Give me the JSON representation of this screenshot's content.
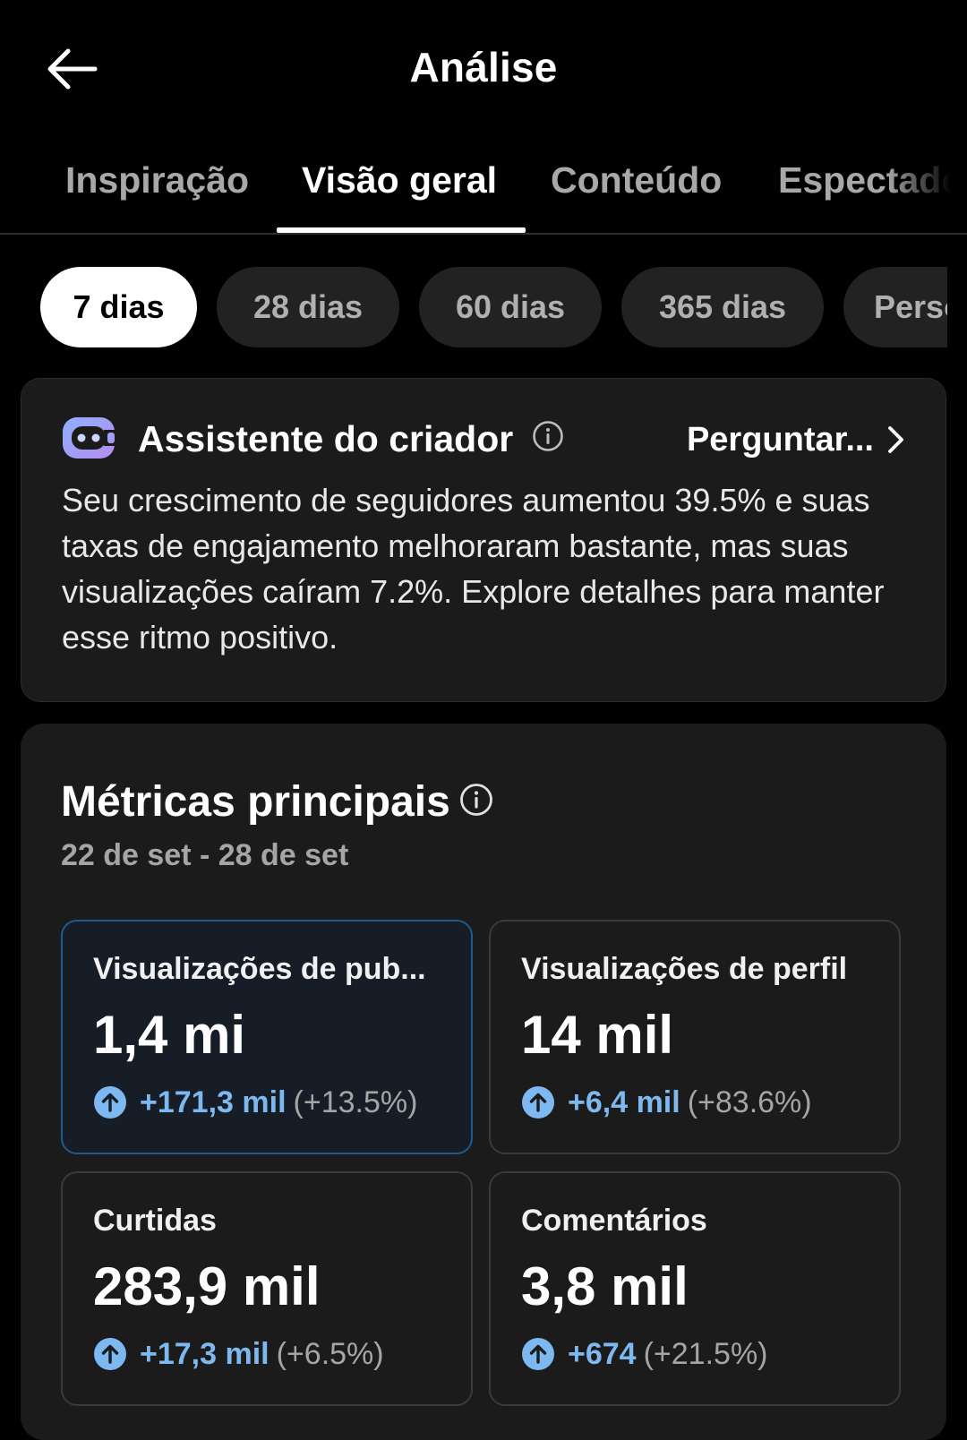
{
  "header": {
    "title": "Análise"
  },
  "tabs": [
    {
      "label": "Inspiração",
      "active": false
    },
    {
      "label": "Visão geral",
      "active": true
    },
    {
      "label": "Conteúdo",
      "active": false
    },
    {
      "label": "Espectadores",
      "active": false
    }
  ],
  "periods": [
    {
      "label": "7 dias",
      "active": true
    },
    {
      "label": "28 dias",
      "active": false
    },
    {
      "label": "60 dias",
      "active": false
    },
    {
      "label": "365 dias",
      "active": false
    },
    {
      "label": "Personalizado",
      "active": false
    }
  ],
  "assistant": {
    "title": "Assistente do criador",
    "ask_label": "Perguntar...",
    "message": "Seu crescimento de seguidores aumentou 39.5% e suas taxas de engajamento melhoraram bastante, mas suas visualizações caíram 7.2%. Explore detalhes para manter esse ritmo positivo."
  },
  "metrics": {
    "title": "Métricas principais",
    "range": "22 de set - 28 de set",
    "tiles": [
      {
        "label": "Visualizações de pub...",
        "value": "1,4 mi",
        "delta": "+171,3 mil",
        "percent": "(+13.5%)",
        "selected": true
      },
      {
        "label": "Visualizações de perfil",
        "value": "14 mil",
        "delta": "+6,4 mil",
        "percent": "(+83.6%)",
        "selected": false
      },
      {
        "label": "Curtidas",
        "value": "283,9 mil",
        "delta": "+17,3 mil",
        "percent": "(+6.5%)",
        "selected": false
      },
      {
        "label": "Comentários",
        "value": "3,8 mil",
        "delta": "+674",
        "percent": "(+21.5%)",
        "selected": false
      }
    ]
  },
  "colors": {
    "accent_blue": "#7eb8f0",
    "background": "#000000",
    "card": "#1b1b1b"
  },
  "icons": {
    "back": "arrow-left-icon",
    "assistant": "bot-face-icon",
    "info": "info-circle-icon",
    "chevron": "chevron-right-icon",
    "up": "arrow-up-circle-icon"
  }
}
